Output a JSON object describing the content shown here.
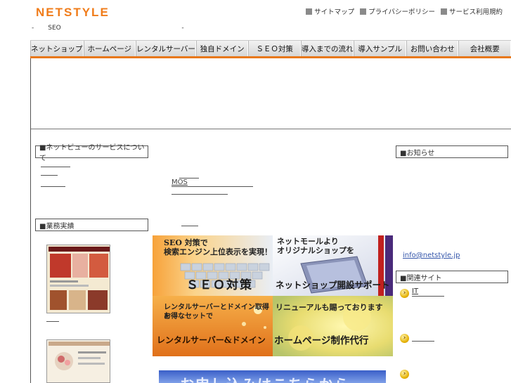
{
  "logo": "NETSTYLE",
  "top_links": [
    {
      "label": "サイトマップ"
    },
    {
      "label": "プライバシーポリシー"
    },
    {
      "label": "サービス利用規約"
    }
  ],
  "tagline": "-       SEO                                                            -",
  "nav": [
    "ネットショップ",
    "ホームページ",
    "レンタルサーバー",
    "独自ドメイン",
    "ＳＥＯ対策",
    "導入までの流れ",
    "導入サンプル",
    "お問い合わせ",
    "会社概要"
  ],
  "sections": {
    "services_title": "■ネットビューのサービスについて",
    "results_title": "■業務実績",
    "news_title": "■お知らせ",
    "related_title": "■関連サイト"
  },
  "center_link": "MOS",
  "promos": [
    {
      "line1": "SEO 対策で",
      "line2": "検索エンジン上位表示を実現！",
      "title": "ＳＥＯ対策"
    },
    {
      "line1": "ネットモールより",
      "line2": "オリジナルショップを",
      "title": "ネットショップ開設サポート"
    },
    {
      "line1": "レンタルサーバーとドメイン取得を",
      "line2": "お得なセットで",
      "title": "レンタルサーバー&ドメイン"
    },
    {
      "line1": "リニューアルも賜っております",
      "line2": "",
      "title": "ホームページ制作代行"
    }
  ],
  "bottom_banner": "お申し込みはこちらから",
  "news_email": "info@netstyle.jp",
  "related": [
    {
      "label": "IT"
    },
    {
      "label": ""
    },
    {
      "label": ""
    }
  ],
  "colors": {
    "brand": "#f07c1a",
    "nav_bar": "#e8781a",
    "link": "#3355aa"
  }
}
